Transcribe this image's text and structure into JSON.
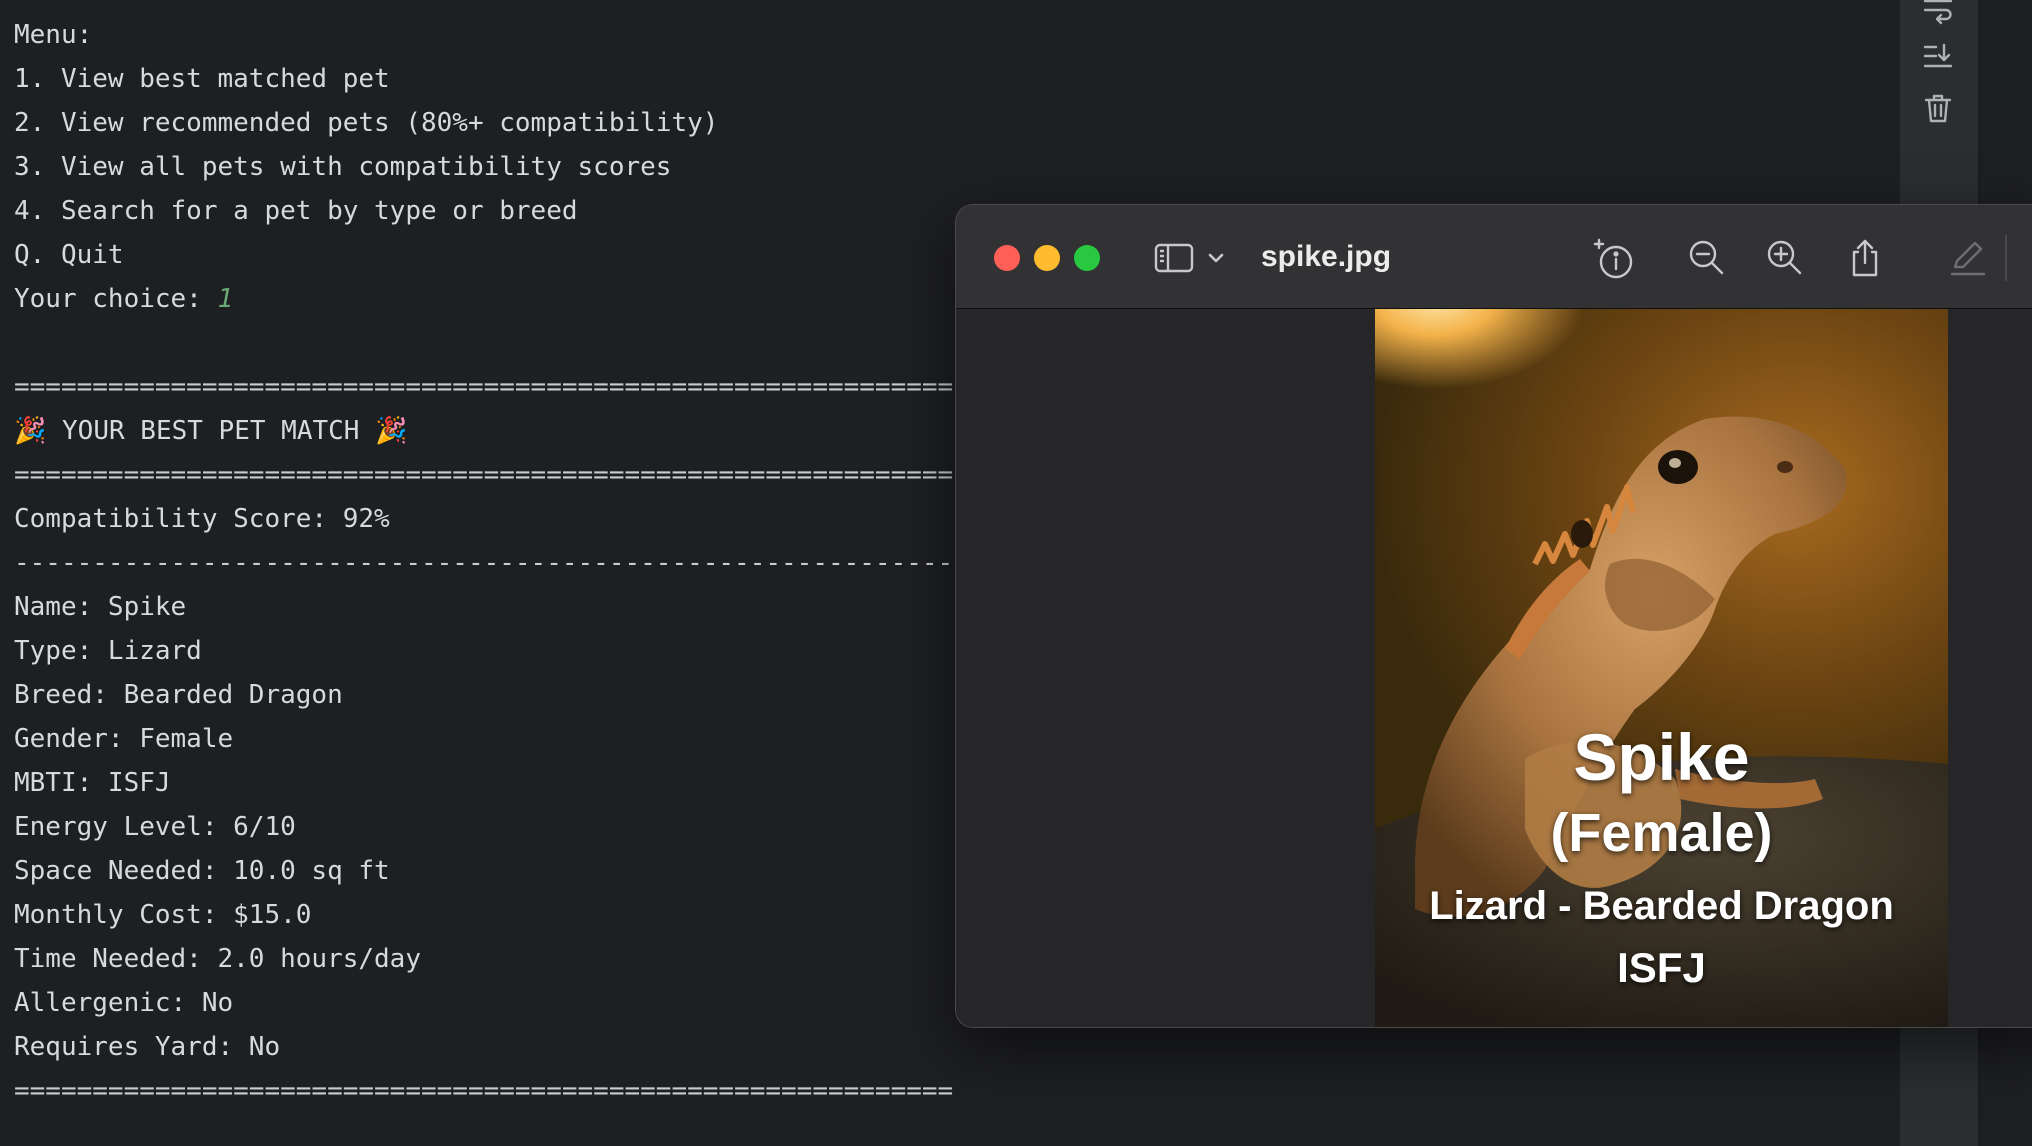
{
  "terminal": {
    "lines": {
      "menu_header": "Menu:",
      "opt1": "1. View best matched pet",
      "opt2": "2. View recommended pets (80%+ compatibility)",
      "opt3": "3. View all pets with compatibility scores",
      "opt4": "4. Search for a pet by type or breed",
      "optq": "Q. Quit",
      "prompt": "Your choice: ",
      "choice": "1",
      "separator_double": "============================================================",
      "heading": "🎉 YOUR BEST PET MATCH 🎉",
      "score": "Compatibility Score: 92%",
      "separator_single": "------------------------------------------------------------",
      "name": "Name: Spike",
      "type": "Type: Lizard",
      "breed": "Breed: Bearded Dragon",
      "gender": "Gender: Female",
      "mbti": "MBTI: ISFJ",
      "energy": "Energy Level: 6/10",
      "space": "Space Needed: 10.0 sq ft",
      "cost": "Monthly Cost: $15.0",
      "time": "Time Needed: 2.0 hours/day",
      "allergenic": "Allergenic: No",
      "yard": "Requires Yard: No"
    }
  },
  "gutter": {
    "icons": [
      "soft-wrap-icon",
      "scroll-to-end-icon",
      "trash-icon"
    ]
  },
  "preview_window": {
    "title": "spike.jpg",
    "toolbar_icons": [
      "sidebar-toggle-icon",
      "chevron-down-icon",
      "info-icon",
      "zoom-out-icon",
      "zoom-in-icon",
      "share-icon",
      "markup-icon"
    ],
    "image_caption": {
      "name": "Spike",
      "gender": "(Female)",
      "type_breed": "Lizard - Bearded Dragon",
      "mbti": "ISFJ"
    }
  },
  "colors": {
    "terminal_bg": "#1e1f22",
    "terminal_text": "#d7d9dd",
    "input_green": "#6aab73",
    "close": "#fe5f57",
    "minimize": "#febc2e",
    "maximize": "#28c840"
  }
}
